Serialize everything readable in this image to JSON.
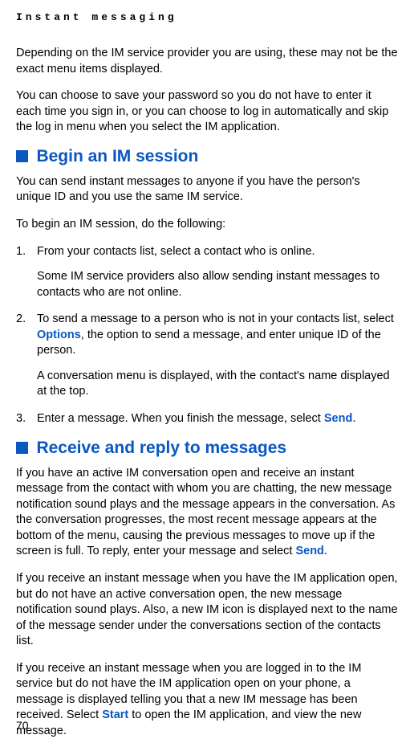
{
  "runningHead": "Instant messaging",
  "intro1": "Depending on the IM service provider you are using, these may not be the exact menu items displayed.",
  "intro2": "You can choose to save your password so you do not have to enter it each time you sign in, or you can choose to log in automatically and skip the log in menu when you select the IM application.",
  "section1": {
    "title": "Begin an IM session",
    "p1": "You can send instant messages to anyone if you have the person's unique ID and you use the same IM service.",
    "p2": "To begin an IM session, do the following:",
    "step1a": "From your contacts list, select a contact who is online.",
    "step1b": "Some IM service providers also allow sending instant messages to contacts who are not online.",
    "step2a_pre": "To send a message to a person who is not in your contacts list, select ",
    "step2a_link": "Options",
    "step2a_post": ", the option to send a message, and enter unique ID of the person.",
    "step2b": "A conversation menu is displayed, with the contact's name displayed at the top.",
    "step3_pre": "Enter a message. When you finish the message, select ",
    "step3_link": "Send",
    "step3_post": "."
  },
  "section2": {
    "title": "Receive and reply to messages",
    "p1_pre": "If you have an active IM conversation open and receive an instant message from the contact with whom you are chatting, the new message notification sound plays and the message appears in the conversation. As the conversation progresses, the most recent message appears at the bottom of the menu, causing the previous messages to move up if the screen is full. To reply, enter your message and select ",
    "p1_link": "Send",
    "p1_post": ".",
    "p2": "If you receive an instant message when you have the IM application open, but do not have an active conversation open, the new message notification sound plays. Also, a new IM icon is displayed next to the name of the message sender under the conversations section of the contacts list.",
    "p3_pre": "If you receive an instant message when you are logged in to the IM service but do not have the IM application open on your phone, a message is displayed telling you that a new IM message has been received. Select ",
    "p3_link": "Start",
    "p3_post": " to open the IM application, and view the new message."
  },
  "pageNumber": "70"
}
